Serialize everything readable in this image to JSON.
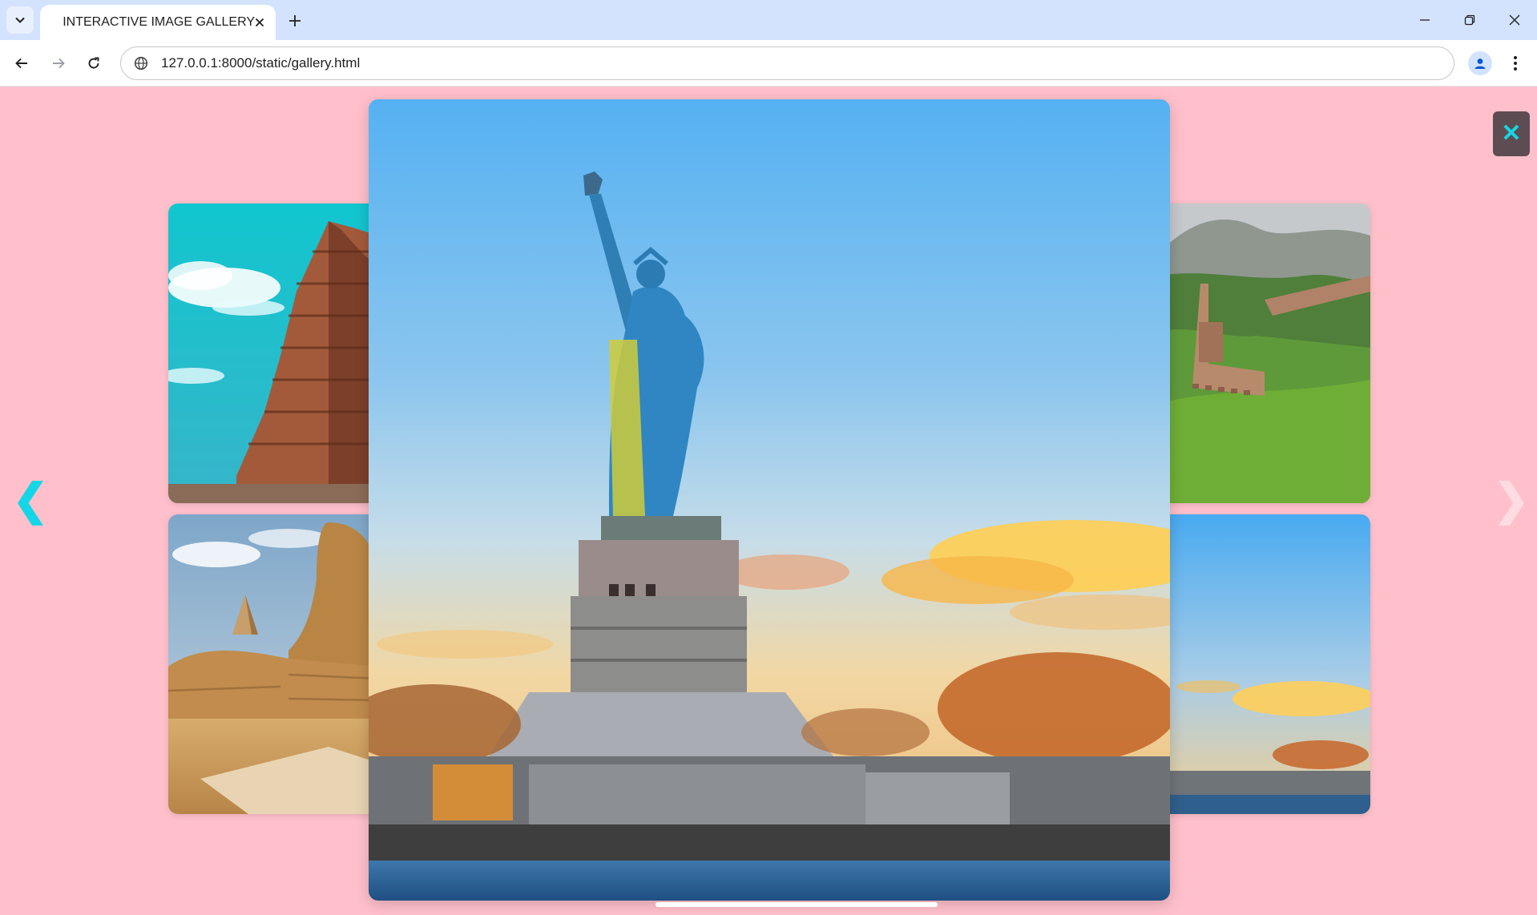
{
  "browser": {
    "tab_title": "INTERACTIVE IMAGE GALLERY",
    "url": "127.0.0.1:8000/static/gallery.html",
    "icons": {
      "tab_menu": "chevron-down-icon",
      "favicon": "globe-icon",
      "tab_close": "close-icon",
      "new_tab": "plus-icon",
      "back": "back-arrow-icon",
      "forward": "forward-arrow-icon",
      "reload": "reload-icon",
      "site_info": "site-info-icon",
      "profile": "profile-icon",
      "menu": "more-vert-icon"
    }
  },
  "gallery": {
    "background_color": "#ffc0cb",
    "accent_color": "#15d6e6",
    "close_label": "✕",
    "prev_label": "❮",
    "next_label": "❯",
    "images": [
      {
        "subject": "temple"
      },
      {
        "subject": "sphinx"
      },
      {
        "subject": "great-wall"
      },
      {
        "subject": "statue-of-liberty"
      }
    ],
    "lightbox_image": {
      "subject": "statue-of-liberty"
    }
  }
}
